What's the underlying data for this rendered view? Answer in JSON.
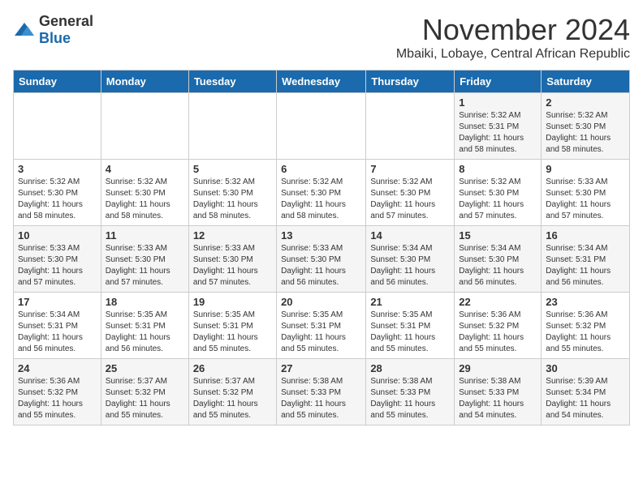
{
  "header": {
    "logo_general": "General",
    "logo_blue": "Blue",
    "month": "November 2024",
    "location": "Mbaiki, Lobaye, Central African Republic"
  },
  "weekdays": [
    "Sunday",
    "Monday",
    "Tuesday",
    "Wednesday",
    "Thursday",
    "Friday",
    "Saturday"
  ],
  "weeks": [
    [
      {
        "day": "",
        "sunrise": "",
        "sunset": "",
        "daylight": ""
      },
      {
        "day": "",
        "sunrise": "",
        "sunset": "",
        "daylight": ""
      },
      {
        "day": "",
        "sunrise": "",
        "sunset": "",
        "daylight": ""
      },
      {
        "day": "",
        "sunrise": "",
        "sunset": "",
        "daylight": ""
      },
      {
        "day": "",
        "sunrise": "",
        "sunset": "",
        "daylight": ""
      },
      {
        "day": "1",
        "sunrise": "Sunrise: 5:32 AM",
        "sunset": "Sunset: 5:31 PM",
        "daylight": "Daylight: 11 hours and 58 minutes."
      },
      {
        "day": "2",
        "sunrise": "Sunrise: 5:32 AM",
        "sunset": "Sunset: 5:30 PM",
        "daylight": "Daylight: 11 hours and 58 minutes."
      }
    ],
    [
      {
        "day": "3",
        "sunrise": "Sunrise: 5:32 AM",
        "sunset": "Sunset: 5:30 PM",
        "daylight": "Daylight: 11 hours and 58 minutes."
      },
      {
        "day": "4",
        "sunrise": "Sunrise: 5:32 AM",
        "sunset": "Sunset: 5:30 PM",
        "daylight": "Daylight: 11 hours and 58 minutes."
      },
      {
        "day": "5",
        "sunrise": "Sunrise: 5:32 AM",
        "sunset": "Sunset: 5:30 PM",
        "daylight": "Daylight: 11 hours and 58 minutes."
      },
      {
        "day": "6",
        "sunrise": "Sunrise: 5:32 AM",
        "sunset": "Sunset: 5:30 PM",
        "daylight": "Daylight: 11 hours and 58 minutes."
      },
      {
        "day": "7",
        "sunrise": "Sunrise: 5:32 AM",
        "sunset": "Sunset: 5:30 PM",
        "daylight": "Daylight: 11 hours and 57 minutes."
      },
      {
        "day": "8",
        "sunrise": "Sunrise: 5:32 AM",
        "sunset": "Sunset: 5:30 PM",
        "daylight": "Daylight: 11 hours and 57 minutes."
      },
      {
        "day": "9",
        "sunrise": "Sunrise: 5:33 AM",
        "sunset": "Sunset: 5:30 PM",
        "daylight": "Daylight: 11 hours and 57 minutes."
      }
    ],
    [
      {
        "day": "10",
        "sunrise": "Sunrise: 5:33 AM",
        "sunset": "Sunset: 5:30 PM",
        "daylight": "Daylight: 11 hours and 57 minutes."
      },
      {
        "day": "11",
        "sunrise": "Sunrise: 5:33 AM",
        "sunset": "Sunset: 5:30 PM",
        "daylight": "Daylight: 11 hours and 57 minutes."
      },
      {
        "day": "12",
        "sunrise": "Sunrise: 5:33 AM",
        "sunset": "Sunset: 5:30 PM",
        "daylight": "Daylight: 11 hours and 57 minutes."
      },
      {
        "day": "13",
        "sunrise": "Sunrise: 5:33 AM",
        "sunset": "Sunset: 5:30 PM",
        "daylight": "Daylight: 11 hours and 56 minutes."
      },
      {
        "day": "14",
        "sunrise": "Sunrise: 5:34 AM",
        "sunset": "Sunset: 5:30 PM",
        "daylight": "Daylight: 11 hours and 56 minutes."
      },
      {
        "day": "15",
        "sunrise": "Sunrise: 5:34 AM",
        "sunset": "Sunset: 5:30 PM",
        "daylight": "Daylight: 11 hours and 56 minutes."
      },
      {
        "day": "16",
        "sunrise": "Sunrise: 5:34 AM",
        "sunset": "Sunset: 5:31 PM",
        "daylight": "Daylight: 11 hours and 56 minutes."
      }
    ],
    [
      {
        "day": "17",
        "sunrise": "Sunrise: 5:34 AM",
        "sunset": "Sunset: 5:31 PM",
        "daylight": "Daylight: 11 hours and 56 minutes."
      },
      {
        "day": "18",
        "sunrise": "Sunrise: 5:35 AM",
        "sunset": "Sunset: 5:31 PM",
        "daylight": "Daylight: 11 hours and 56 minutes."
      },
      {
        "day": "19",
        "sunrise": "Sunrise: 5:35 AM",
        "sunset": "Sunset: 5:31 PM",
        "daylight": "Daylight: 11 hours and 55 minutes."
      },
      {
        "day": "20",
        "sunrise": "Sunrise: 5:35 AM",
        "sunset": "Sunset: 5:31 PM",
        "daylight": "Daylight: 11 hours and 55 minutes."
      },
      {
        "day": "21",
        "sunrise": "Sunrise: 5:35 AM",
        "sunset": "Sunset: 5:31 PM",
        "daylight": "Daylight: 11 hours and 55 minutes."
      },
      {
        "day": "22",
        "sunrise": "Sunrise: 5:36 AM",
        "sunset": "Sunset: 5:32 PM",
        "daylight": "Daylight: 11 hours and 55 minutes."
      },
      {
        "day": "23",
        "sunrise": "Sunrise: 5:36 AM",
        "sunset": "Sunset: 5:32 PM",
        "daylight": "Daylight: 11 hours and 55 minutes."
      }
    ],
    [
      {
        "day": "24",
        "sunrise": "Sunrise: 5:36 AM",
        "sunset": "Sunset: 5:32 PM",
        "daylight": "Daylight: 11 hours and 55 minutes."
      },
      {
        "day": "25",
        "sunrise": "Sunrise: 5:37 AM",
        "sunset": "Sunset: 5:32 PM",
        "daylight": "Daylight: 11 hours and 55 minutes."
      },
      {
        "day": "26",
        "sunrise": "Sunrise: 5:37 AM",
        "sunset": "Sunset: 5:32 PM",
        "daylight": "Daylight: 11 hours and 55 minutes."
      },
      {
        "day": "27",
        "sunrise": "Sunrise: 5:38 AM",
        "sunset": "Sunset: 5:33 PM",
        "daylight": "Daylight: 11 hours and 55 minutes."
      },
      {
        "day": "28",
        "sunrise": "Sunrise: 5:38 AM",
        "sunset": "Sunset: 5:33 PM",
        "daylight": "Daylight: 11 hours and 55 minutes."
      },
      {
        "day": "29",
        "sunrise": "Sunrise: 5:38 AM",
        "sunset": "Sunset: 5:33 PM",
        "daylight": "Daylight: 11 hours and 54 minutes."
      },
      {
        "day": "30",
        "sunrise": "Sunrise: 5:39 AM",
        "sunset": "Sunset: 5:34 PM",
        "daylight": "Daylight: 11 hours and 54 minutes."
      }
    ]
  ]
}
